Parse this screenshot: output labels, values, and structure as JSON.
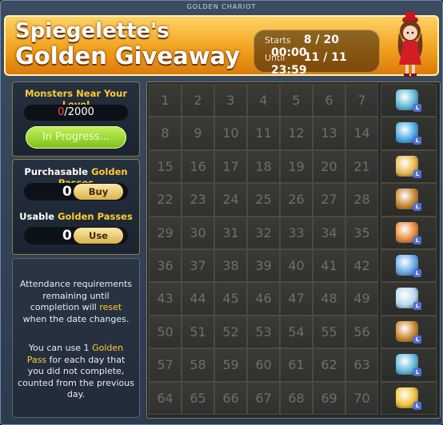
{
  "window": {
    "title": "GOLDEN CHARIOT"
  },
  "banner": {
    "title_line1": "Spiegelette's",
    "title_line2": "Golden Giveaway",
    "starts_label": "Starts",
    "starts_date": "8 / 20",
    "starts_time": "00:00",
    "until_label": "Until",
    "until_date": "11 / 11",
    "until_time": "23:59"
  },
  "monsters": {
    "heading": "Monsters Near Your Level",
    "current": "0",
    "total": "/2000",
    "button": "In Progress..."
  },
  "passes": {
    "purchasable_label_a": "Purchasable ",
    "purchasable_label_b": "Golden Passes",
    "purchasable_count": "0",
    "buy_button": "Buy",
    "usable_label_a": "Usable ",
    "usable_label_b": "Golden Passes",
    "usable_count": "0",
    "use_button": "Use"
  },
  "notice": {
    "p1_a": "Attendance requirements remaining until completion will ",
    "p1_b": "reset",
    "p1_c": " when the date changes.",
    "p2_a": "You can use 1 ",
    "p2_b": "Golden Pass",
    "p2_c": " for each day that you did not complete, counted from the previous day."
  },
  "days": [
    "1",
    "2",
    "3",
    "4",
    "5",
    "6",
    "7",
    "8",
    "9",
    "10",
    "11",
    "12",
    "13",
    "14",
    "15",
    "16",
    "17",
    "18",
    "19",
    "20",
    "21",
    "22",
    "23",
    "24",
    "25",
    "26",
    "27",
    "28",
    "29",
    "30",
    "31",
    "32",
    "33",
    "34",
    "35",
    "36",
    "37",
    "38",
    "39",
    "40",
    "41",
    "42",
    "43",
    "44",
    "45",
    "46",
    "47",
    "48",
    "49",
    "50",
    "51",
    "52",
    "53",
    "54",
    "55",
    "56",
    "57",
    "58",
    "59",
    "60",
    "61",
    "62",
    "63",
    "64",
    "65",
    "66",
    "67",
    "68",
    "69",
    "70"
  ],
  "rewards": [
    {
      "icon": "scroll-card-icon",
      "color": "#5fb8d8",
      "level_badge": "L"
    },
    {
      "icon": "sparkle-orb-icon",
      "color": "#49a8e8",
      "level_badge": "L"
    },
    {
      "icon": "potion-pouch-icon",
      "color": "#e8b84a",
      "level_badge": "L"
    },
    {
      "icon": "wheel-card-icon",
      "color": "#c9862e",
      "level_badge": "L"
    },
    {
      "icon": "pet-icon",
      "color": "#e88a3a",
      "level_badge": "L"
    },
    {
      "icon": "mystery-question-icon",
      "color": "#6aa8e8",
      "level_badge": "L"
    },
    {
      "icon": "crystal-cluster-icon",
      "color": "#b8d8ee",
      "level_badge": "L"
    },
    {
      "icon": "wheel-card-icon",
      "color": "#c9862e",
      "level_badge": "L"
    },
    {
      "icon": "scroll-card-icon",
      "color": "#5fb8d8",
      "level_badge": "L"
    },
    {
      "icon": "gold-treasure-icon",
      "color": "#f2c23a",
      "level_badge": "L"
    }
  ]
}
